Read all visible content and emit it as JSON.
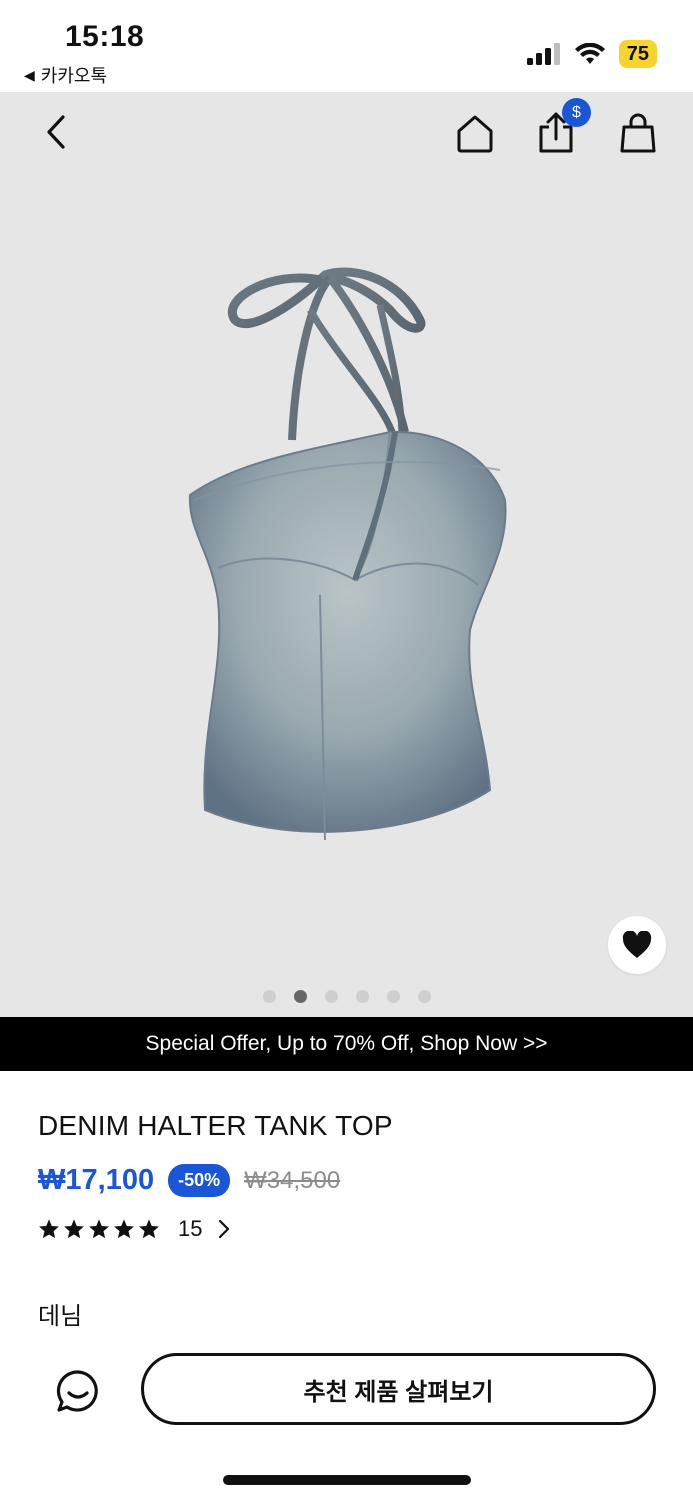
{
  "status_bar": {
    "time": "15:18",
    "back_app": "카카오톡",
    "battery": "75"
  },
  "header": {
    "cart_badge": "$"
  },
  "gallery": {
    "image_count": 6,
    "active_index": 1
  },
  "promo": {
    "text": "Special Offer, Up to 70% Off, Shop Now >>"
  },
  "product": {
    "title": "DENIM HALTER TANK TOP",
    "price": "₩17,100",
    "discount": "-50%",
    "original_price": "₩34,500",
    "rating": 5,
    "review_count": "15",
    "category": "데님"
  },
  "actions": {
    "recommend_label": "추천 제품 살펴보기"
  },
  "colors": {
    "accent": "#1a56d6",
    "battery": "#f6d32d",
    "hero_bg": "#e6e6e6",
    "promo_bg": "#000000"
  }
}
